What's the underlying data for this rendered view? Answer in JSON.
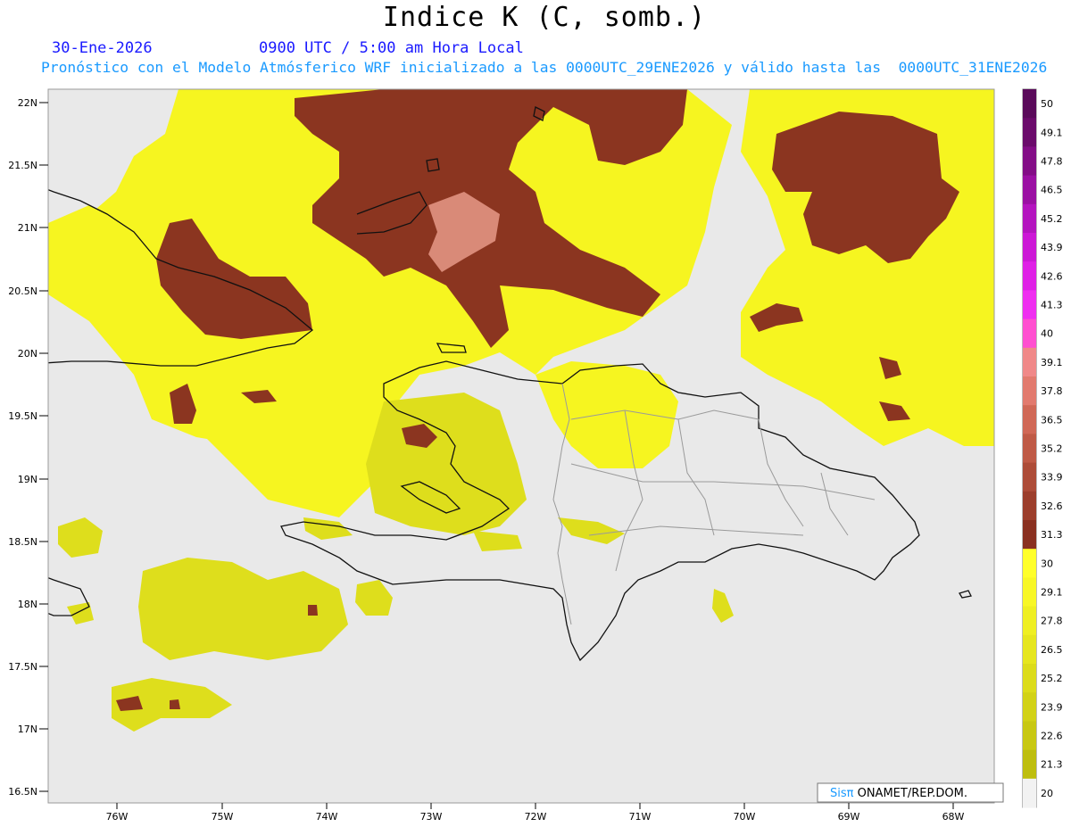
{
  "header": {
    "title": "Indice K (C, somb.)",
    "date": "30-Ene-2026",
    "valid_time": "0900 UTC / 5:00 am Hora Local",
    "description": "Pronóstico con el Modelo Atmósferico WRF inicializado a las 0000UTC_29ENE2026 y válido hasta las  0000UTC_31ENE2026"
  },
  "map": {
    "lat_labels": [
      "22N",
      "21.5N",
      "21N",
      "20.5N",
      "20N",
      "19.5N",
      "19N",
      "18.5N",
      "18N",
      "17.5N",
      "17N",
      "16.5N"
    ],
    "lon_labels": [
      "76W",
      "75W",
      "74W",
      "73W",
      "72W",
      "71W",
      "70W",
      "69W",
      "68W"
    ],
    "background_color": "#e9e9e9"
  },
  "colorbar": {
    "labels": [
      "50",
      "49.1",
      "47.8",
      "46.5",
      "45.2",
      "43.9",
      "42.6",
      "41.3",
      "40",
      "39.1",
      "37.8",
      "36.5",
      "35.2",
      "33.9",
      "32.6",
      "31.3",
      "30",
      "29.1",
      "27.8",
      "26.5",
      "25.2",
      "23.9",
      "22.6",
      "21.3",
      "20"
    ],
    "colors": [
      "#5a0a5a",
      "#6b0b6b",
      "#830d86",
      "#9b10a3",
      "#b414bf",
      "#cc18d6",
      "#df20e6",
      "#ef2ef0",
      "#ff4fd0",
      "#f08888",
      "#e27a6e",
      "#d06856",
      "#bf5a46",
      "#ad4c38",
      "#9c3e2c",
      "#8a3020",
      "#ffff2a",
      "#f8f726",
      "#efef22",
      "#e6e61e",
      "#dcdc1a",
      "#d2d216",
      "#c8c812",
      "#bebe0e",
      "#f2f2f2"
    ]
  },
  "credit": {
    "brand": "Sisπ",
    "text": " ONAMET/REP.DOM."
  }
}
